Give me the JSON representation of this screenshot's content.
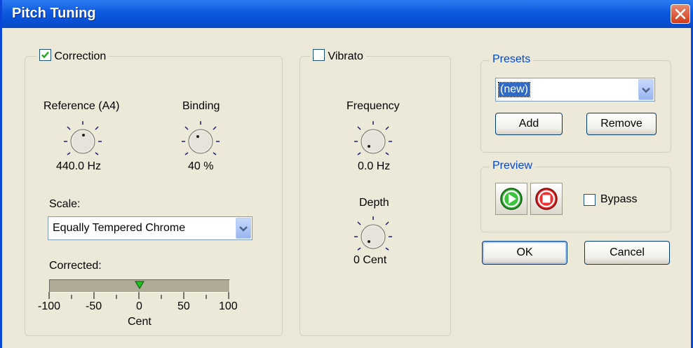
{
  "window": {
    "title": "Pitch Tuning"
  },
  "correction": {
    "label": "Correction",
    "checked": true,
    "reference": {
      "label": "Reference (A4)",
      "value": "440.0 Hz"
    },
    "binding": {
      "label": "Binding",
      "value": "40 %"
    },
    "scale": {
      "label": "Scale:",
      "value": "Equally Tempered Chrome"
    },
    "corrected": {
      "label": "Corrected:",
      "ticks": [
        "-100",
        "-50",
        "0",
        "50",
        "100"
      ],
      "unit": "Cent",
      "marker_value": 0
    }
  },
  "vibrato": {
    "label": "Vibrato",
    "checked": false,
    "frequency": {
      "label": "Frequency",
      "value": "0.0 Hz"
    },
    "depth": {
      "label": "Depth",
      "value": "0 Cent"
    }
  },
  "presets": {
    "label": "Presets",
    "selected": "(new)",
    "add_label": "Add",
    "remove_label": "Remove"
  },
  "preview": {
    "label": "Preview",
    "bypass_label": "Bypass",
    "bypass_checked": false
  },
  "buttons": {
    "ok_label": "OK",
    "cancel_label": "Cancel"
  },
  "colors": {
    "titlebar": "#0a4ac6",
    "close": "#d23a18",
    "group_legend": "#0046d5",
    "play": "#2aa82a",
    "stop": "#e02020",
    "marker": "#20c020"
  }
}
